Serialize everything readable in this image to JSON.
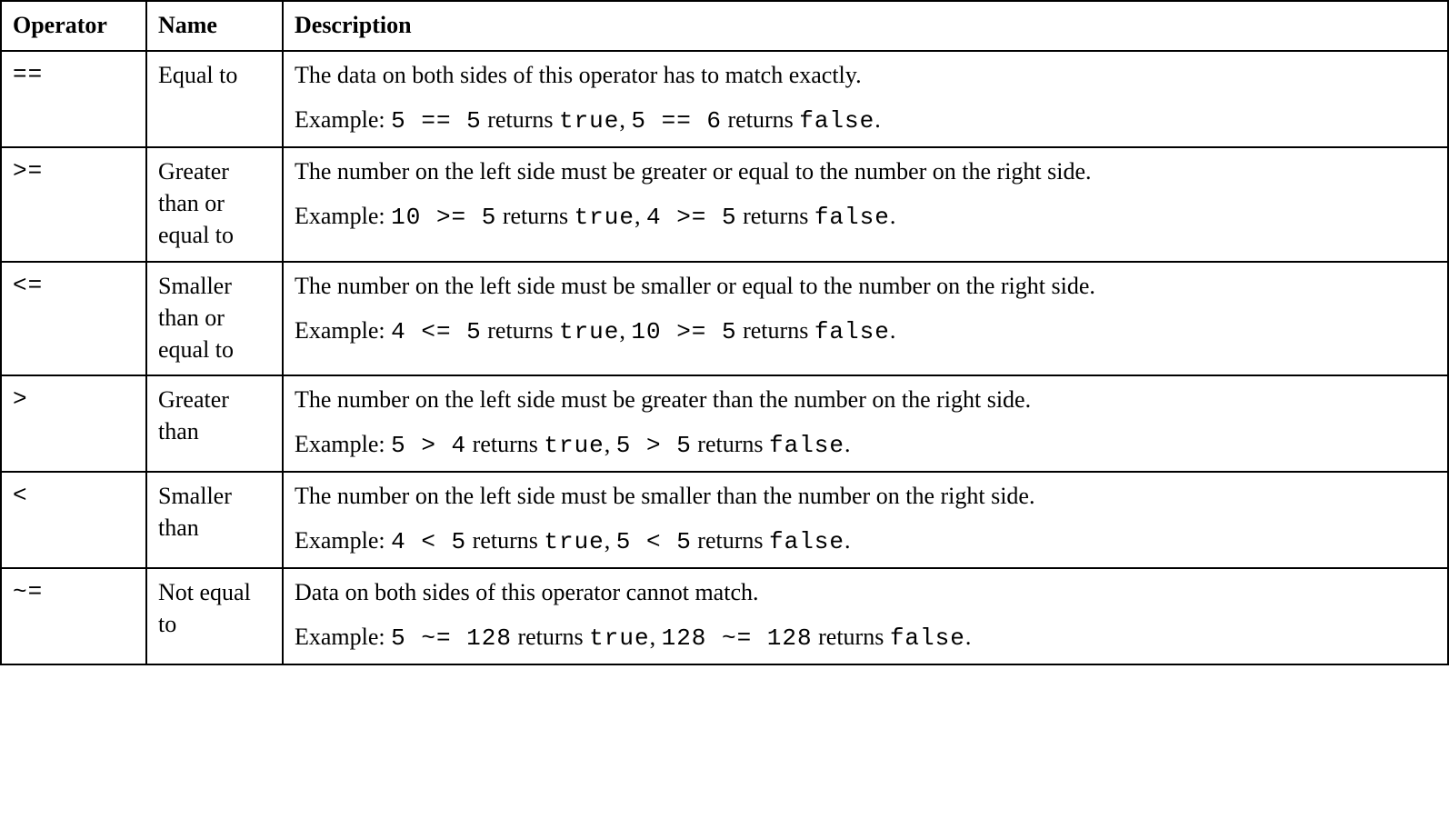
{
  "headers": {
    "operator": "Operator",
    "name": "Name",
    "description": "Description"
  },
  "rows": [
    {
      "operator": "==",
      "name": "Equal to",
      "desc_line": "The data on both sides of this operator has to match exactly.",
      "example_prefix": "Example: ",
      "ex1_code": "5 == 5",
      "ex1_mid": " returns ",
      "ex1_res": "true",
      "ex_sep": ", ",
      "ex2_code": "5 == 6",
      "ex2_mid": " returns ",
      "ex2_res": "false",
      "ex_end": "."
    },
    {
      "operator": ">=",
      "name": "Greater than or equal to",
      "desc_line": "The number on the left side must be greater or equal to the number on the right side.",
      "example_prefix": "Example: ",
      "ex1_code": "10 >= 5",
      "ex1_mid": " returns ",
      "ex1_res": "true",
      "ex_sep": ", ",
      "ex2_code": "4 >= 5",
      "ex2_mid": " returns ",
      "ex2_res": "false",
      "ex_end": "."
    },
    {
      "operator": "<=",
      "name": "Smaller than or equal to",
      "desc_line": "The number on the left side must be smaller or equal to the number on the right side.",
      "example_prefix": "Example: ",
      "ex1_code": "4 <= 5",
      "ex1_mid": " returns ",
      "ex1_res": "true",
      "ex_sep": ", ",
      "ex2_code": "10 >= 5",
      "ex2_mid": " returns ",
      "ex2_res": "false",
      "ex_end": "."
    },
    {
      "operator": ">",
      "name": "Greater than",
      "desc_line": "The number on the left side must be greater than the number on the right side.",
      "example_prefix": "Example: ",
      "ex1_code": "5 > 4",
      "ex1_mid": " returns ",
      "ex1_res": "true",
      "ex_sep": ", ",
      "ex2_code": "5 > 5",
      "ex2_mid": " returns ",
      "ex2_res": "false",
      "ex_end": "."
    },
    {
      "operator": "<",
      "name": "Smaller than",
      "desc_line": "The number on the left side must be smaller than the number on the right side.",
      "example_prefix": "Example: ",
      "ex1_code": "4 < 5",
      "ex1_mid": " returns ",
      "ex1_res": "true",
      "ex_sep": ", ",
      "ex2_code": "5 < 5",
      "ex2_mid": " returns ",
      "ex2_res": "false",
      "ex_end": "."
    },
    {
      "operator": "~=",
      "name": "Not equal to",
      "desc_line": "Data on both sides of this operator cannot match.",
      "example_prefix": "Example: ",
      "ex1_code": "5 ~= 128",
      "ex1_mid": " returns ",
      "ex1_res": "true",
      "ex_sep": ", ",
      "ex2_code": "128 ~= 128",
      "ex2_mid": " returns ",
      "ex2_res": "false",
      "ex_end": "."
    }
  ]
}
